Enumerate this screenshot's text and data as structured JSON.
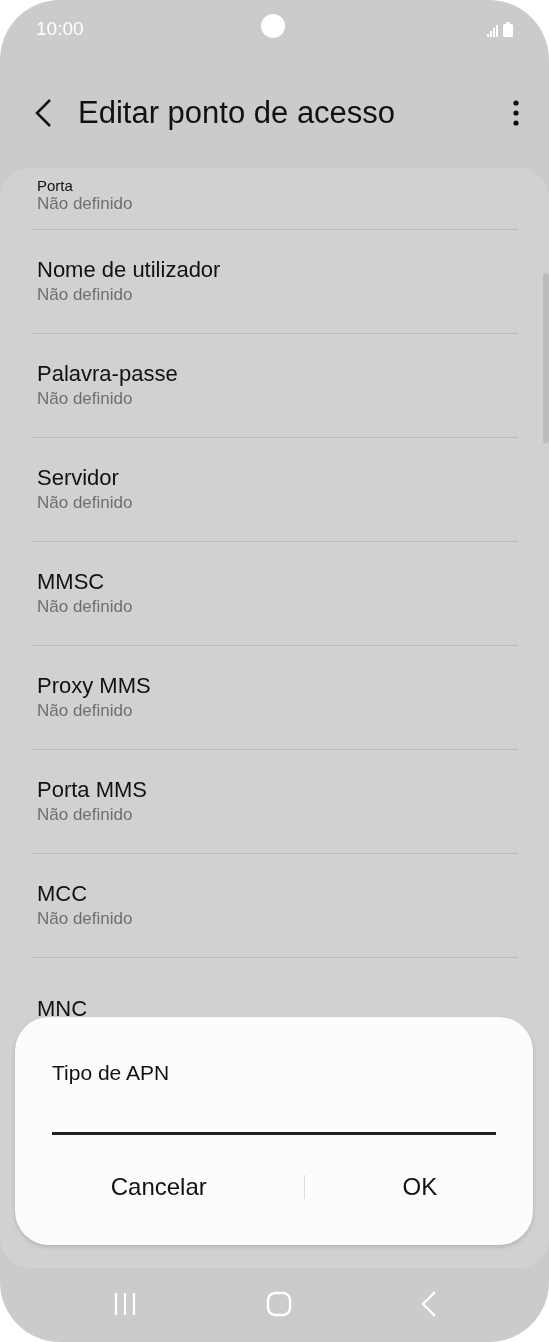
{
  "status_bar": {
    "time": "10:00"
  },
  "header": {
    "title": "Editar ponto de acesso"
  },
  "settings": [
    {
      "title": "Porta",
      "value": "Não definido"
    },
    {
      "title": "Nome de utilizador",
      "value": "Não definido"
    },
    {
      "title": "Palavra-passe",
      "value": "Não definido"
    },
    {
      "title": "Servidor",
      "value": "Não definido"
    },
    {
      "title": "MMSC",
      "value": "Não definido"
    },
    {
      "title": "Proxy MMS",
      "value": "Não definido"
    },
    {
      "title": "Porta MMS",
      "value": "Não definido"
    },
    {
      "title": "MCC",
      "value": "Não definido"
    },
    {
      "title": "MNC"
    }
  ],
  "dialog": {
    "title": "Tipo de APN",
    "buttons": [
      "Cancelar",
      "OK"
    ]
  }
}
